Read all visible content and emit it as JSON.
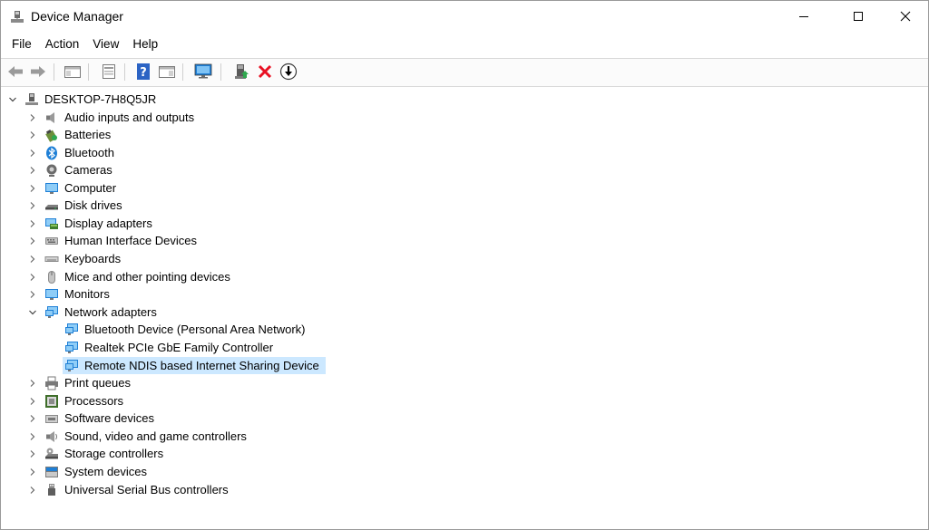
{
  "window": {
    "title": "Device Manager"
  },
  "menu": [
    "File",
    "Action",
    "View",
    "Help"
  ],
  "tree": {
    "root": "DESKTOP-7H8Q5JR",
    "categories": [
      {
        "label": "Audio inputs and outputs",
        "icon": "speaker-icon"
      },
      {
        "label": "Batteries",
        "icon": "battery-icon"
      },
      {
        "label": "Bluetooth",
        "icon": "bluetooth-icon"
      },
      {
        "label": "Cameras",
        "icon": "camera-icon"
      },
      {
        "label": "Computer",
        "icon": "computer-icon"
      },
      {
        "label": "Disk drives",
        "icon": "disk-drive-icon"
      },
      {
        "label": "Display adapters",
        "icon": "display-adapter-icon"
      },
      {
        "label": "Human Interface Devices",
        "icon": "hid-icon"
      },
      {
        "label": "Keyboards",
        "icon": "keyboard-icon"
      },
      {
        "label": "Mice and other pointing devices",
        "icon": "mouse-icon"
      },
      {
        "label": "Monitors",
        "icon": "monitor-icon"
      },
      {
        "label": "Network adapters",
        "icon": "network-adapter-icon",
        "expanded": true,
        "children": [
          {
            "label": "Bluetooth Device (Personal Area Network)"
          },
          {
            "label": "Realtek PCIe GbE Family Controller"
          },
          {
            "label": "Remote NDIS based Internet Sharing Device",
            "selected": true
          }
        ]
      },
      {
        "label": "Print queues",
        "icon": "printer-icon"
      },
      {
        "label": "Processors",
        "icon": "processor-icon"
      },
      {
        "label": "Software devices",
        "icon": "software-device-icon"
      },
      {
        "label": "Sound, video and game controllers",
        "icon": "sound-controller-icon"
      },
      {
        "label": "Storage controllers",
        "icon": "storage-controller-icon"
      },
      {
        "label": "System devices",
        "icon": "system-device-icon"
      },
      {
        "label": "Universal Serial Bus controllers",
        "icon": "usb-icon"
      }
    ]
  },
  "colors": {
    "selection": "#cce8ff",
    "accent": "#1e7fd6",
    "delete": "#e81123"
  }
}
